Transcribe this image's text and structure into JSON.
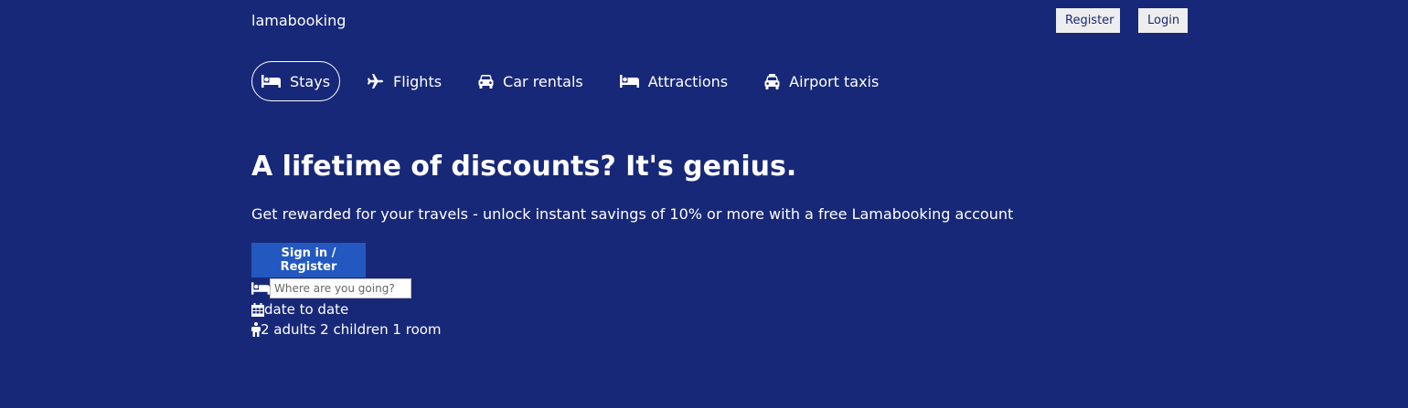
{
  "header": {
    "logo": "lamabooking",
    "register_label": "Register",
    "login_label": "Login"
  },
  "tabs": [
    {
      "label": "Stays",
      "icon": "bed-icon",
      "active": true
    },
    {
      "label": "Flights",
      "icon": "plane-icon",
      "active": false
    },
    {
      "label": "Car rentals",
      "icon": "car-icon",
      "active": false
    },
    {
      "label": "Attractions",
      "icon": "bed-icon",
      "active": false
    },
    {
      "label": "Airport taxis",
      "icon": "taxi-icon",
      "active": false
    }
  ],
  "hero": {
    "title": "A lifetime of discounts? It's genius.",
    "description": "Get rewarded for your travels - unlock instant savings of 10% or more with a free Lamabooking account",
    "signin_label": "Sign in / Register"
  },
  "search": {
    "destination_placeholder": "Where are you going?",
    "date_text": "date to date",
    "options_text": "2 adults 2 children 1 room"
  },
  "colors": {
    "background": "#182878",
    "primary_button": "#2258c0",
    "text": "#ffffff"
  }
}
